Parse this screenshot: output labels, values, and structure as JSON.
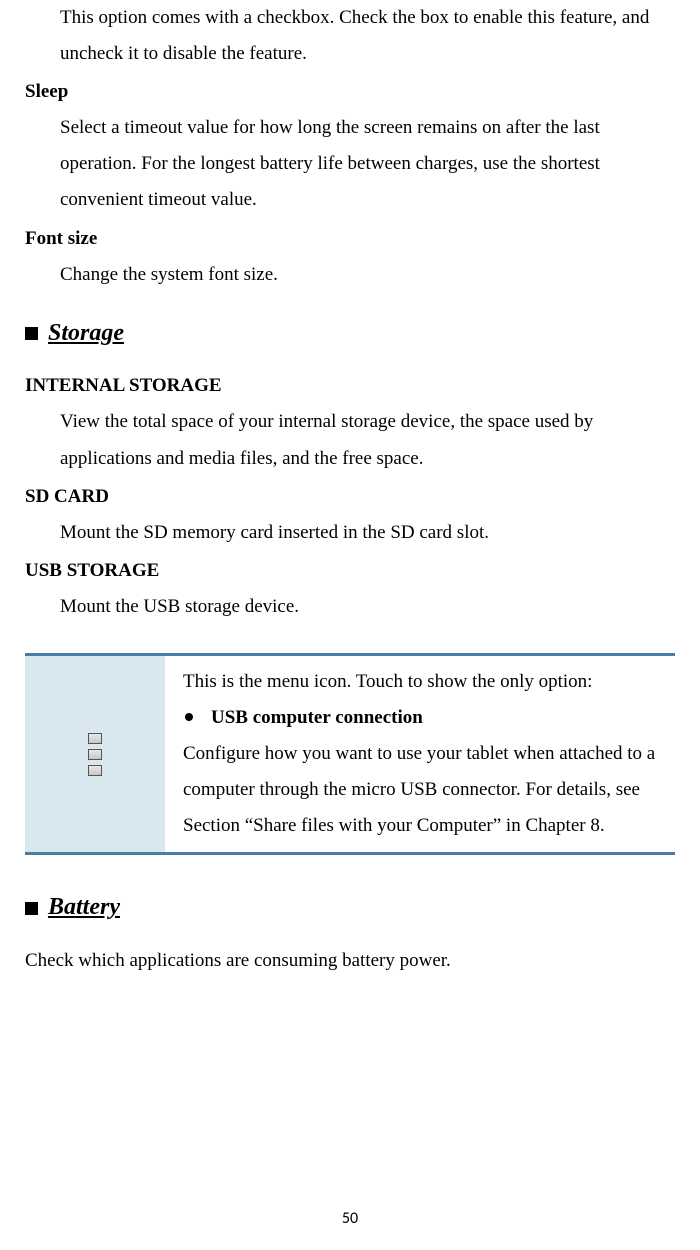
{
  "top": {
    "checkbox_note": "This option comes with a checkbox. Check the box to enable this feature, and uncheck it to disable the feature.",
    "sleep_heading": "Sleep",
    "sleep_body": "Select a timeout value for how long the screen remains on after the last operation. For the longest battery life between charges, use the shortest convenient timeout value.",
    "font_heading": "Font size",
    "font_body": "Change the system font size."
  },
  "storage": {
    "title": "Storage",
    "internal_heading": "INTERNAL STORAGE",
    "internal_body": "View the total space of your internal storage device, the space used by applications and media files, and the free space.",
    "sd_heading": "SD CARD",
    "sd_body": "Mount the SD memory card inserted in the SD card slot.",
    "usb_heading": "USB STORAGE",
    "usb_body": "Mount the USB storage device."
  },
  "info": {
    "intro": "This is the menu icon. Touch to show the only option:",
    "bullet_label": "USB computer connection",
    "bullet_body": "Configure how you want to use your tablet when attached to a computer through the micro USB connector. For details, see Section “Share files with your Computer” in Chapter 8."
  },
  "battery": {
    "title": "Battery",
    "body": "Check which applications are consuming battery power."
  },
  "page_number": "50"
}
